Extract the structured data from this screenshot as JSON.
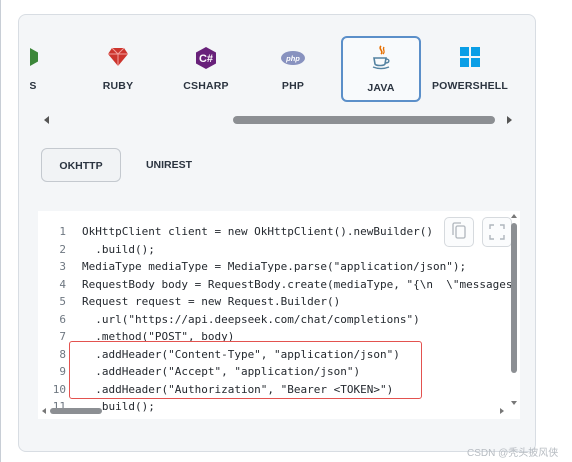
{
  "languages": [
    {
      "label": "JS",
      "icon": "nodejs-icon",
      "color": "#3c873a"
    },
    {
      "label": "RUBY",
      "icon": "ruby-icon",
      "color": "#cc342d"
    },
    {
      "label": "CSHARP",
      "icon": "csharp-icon",
      "color": "#68217a"
    },
    {
      "label": "PHP",
      "icon": "php-icon",
      "color": "#8892bf"
    },
    {
      "label": "JAVA",
      "icon": "java-icon",
      "color": "#e76f00",
      "active": true
    },
    {
      "label": "POWERSHELL",
      "icon": "windows-icon",
      "color": "#0a9ee6"
    }
  ],
  "tabs": {
    "okhttp": "OKHTTP",
    "unirest": "UNIREST"
  },
  "code": {
    "lines": [
      {
        "n": "1",
        "t": "OkHttpClient client = new OkHttpClient().newBuilder()"
      },
      {
        "n": "2",
        "t": "  .build();"
      },
      {
        "n": "3",
        "t": "MediaType mediaType = MediaType.parse(\"application/json\");"
      },
      {
        "n": "4",
        "t": "RequestBody body = RequestBody.create(mediaType, \"{\\n  \\\"messages"
      },
      {
        "n": "5",
        "t": "Request request = new Request.Builder()"
      },
      {
        "n": "6",
        "t": "  .url(\"https://api.deepseek.com/chat/completions\")"
      },
      {
        "n": "7",
        "t": "  .method(\"POST\", body)"
      },
      {
        "n": "8",
        "t": "  .addHeader(\"Content-Type\", \"application/json\")"
      },
      {
        "n": "9",
        "t": "  .addHeader(\"Accept\", \"application/json\")"
      },
      {
        "n": "10",
        "t": "  .addHeader(\"Authorization\", \"Bearer <TOKEN>\")"
      },
      {
        "n": "11",
        "t": "  .build();"
      }
    ]
  },
  "highlight_color": "#e3524f",
  "watermark": "CSDN @秃头披风侠"
}
